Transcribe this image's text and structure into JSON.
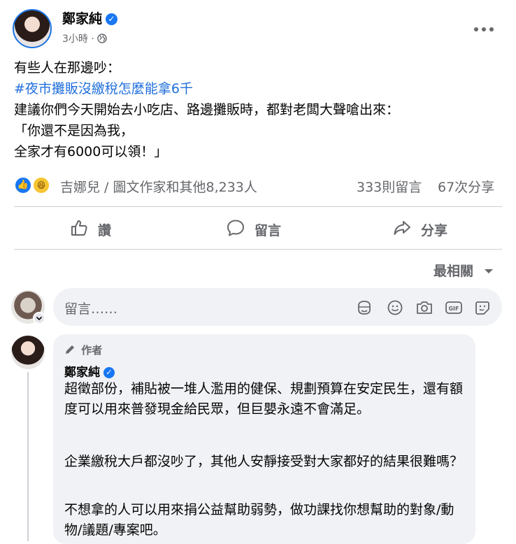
{
  "post": {
    "author": "鄭家純",
    "time": "3小時",
    "separator": "·",
    "lines": {
      "line1": "有些人在那邊吵：",
      "hashtag": "#夜市攤販沒繳稅怎麼能拿6千",
      "line3": "建議你們今天開始去小吃店、路邊攤販時，都對老闆大聲嗆出來：",
      "line4": "「你還不是因為我，",
      "line5": "全家才有6000可以領！」"
    },
    "reactions_text": "吉娜兒 / 圖文作家和其他8,233人",
    "comments_count": "333則留言",
    "shares_count": "67次分享"
  },
  "actions": {
    "like": "讚",
    "comment": "留言",
    "share": "分享"
  },
  "sort": {
    "label": "最相關"
  },
  "composer": {
    "placeholder": "留言……"
  },
  "comment": {
    "author_badge": "作者",
    "author": "鄭家純",
    "paragraphs": {
      "p1": "超徵部份，補貼被一堆人濫用的健保、規劃預算在安定民生，還有額度可以用來普發現金給民眾，但巨嬰永遠不會滿足。",
      "p2": "企業繳稅大戶都沒吵了，其他人安靜接受對大家都好的結果很難嗎？",
      "p3": "不想拿的人可以用來捐公益幫助弱勢，做功課找你想幫助的對象/動物/議題/專案吧。"
    }
  },
  "icons": {
    "globe": "globe-icon",
    "more": "more-options-icon",
    "like": "thumbs-up-icon",
    "comment": "comment-bubble-icon",
    "share": "share-arrow-icon",
    "sticker": "sticker-icon",
    "emoji": "emoji-icon",
    "camera": "camera-icon",
    "gif": "gif-icon",
    "avatar_sticker": "avatar-sticker-icon",
    "pencil": "pencil-icon",
    "chevron": "chevron-down-icon"
  },
  "colors": {
    "accent": "#1877f2",
    "hashtag": "#216fdb",
    "secondary_text": "#65676b",
    "bubble_bg": "#f0f2f5"
  }
}
